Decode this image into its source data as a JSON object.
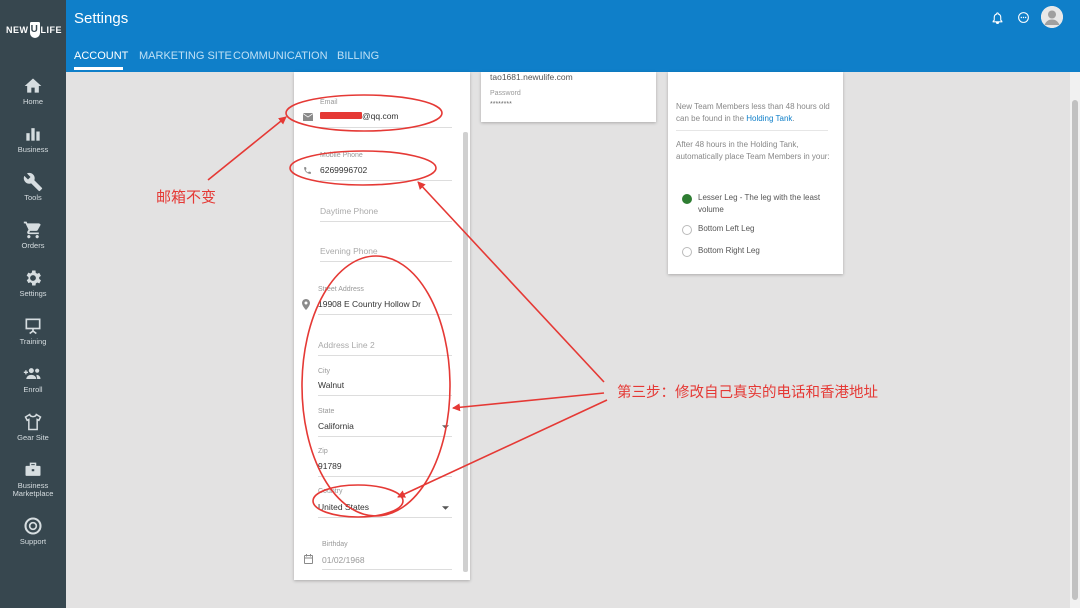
{
  "sidebar": {
    "logo_left": "NEW",
    "logo_mid": "U",
    "logo_right": "LIFE",
    "items": [
      {
        "label": "Home",
        "icon": "home-icon"
      },
      {
        "label": "Business",
        "icon": "bar-chart-icon"
      },
      {
        "label": "Tools",
        "icon": "wrench-icon"
      },
      {
        "label": "Orders",
        "icon": "cart-icon"
      },
      {
        "label": "Settings",
        "icon": "gear-icon"
      },
      {
        "label": "Training",
        "icon": "presentation-icon"
      },
      {
        "label": "Enroll",
        "icon": "add-people-icon"
      },
      {
        "label": "Gear Site",
        "icon": "shirt-icon"
      },
      {
        "label": "Business Marketplace",
        "icon": "briefcase-icon"
      },
      {
        "label": "Support",
        "icon": "lifebuoy-icon"
      }
    ]
  },
  "header": {
    "title": "Settings",
    "tabs": [
      "ACCOUNT",
      "MARKETING SITE",
      "COMMUNICATION",
      "BILLING"
    ],
    "active_tab": "ACCOUNT"
  },
  "form": {
    "email_label": "Email",
    "email_value": "@qq.com",
    "mobile_label": "Mobile Phone",
    "mobile_value": "6269996702",
    "daytime_placeholder": "Daytime Phone",
    "evening_placeholder": "Evening Phone",
    "street_label": "Street Address",
    "street_value": "19908 E Country Hollow Dr",
    "address2_placeholder": "Address Line 2",
    "city_label": "City",
    "city_value": "Walnut",
    "state_label": "State",
    "state_value": "California",
    "zip_label": "Zip",
    "zip_value": "91789",
    "country_label": "Country",
    "country_value": "United States",
    "birthday_label": "Birthday",
    "birthday_value": "01/02/1968"
  },
  "site_card": {
    "url": "tao1681.newulife.com",
    "password_label": "Password",
    "password_value": "********"
  },
  "tank_card": {
    "text1_before": "New Team Members less than 48 hours old can be found in the ",
    "text1_link": "Holding Tank",
    "text1_after": ".",
    "text2": "After 48 hours in the Holding Tank, automatically place Team Members in your:",
    "options": [
      "Lesser Leg - The leg with the least volume",
      "Bottom Left Leg",
      "Bottom Right Leg"
    ],
    "selected_index": 0
  },
  "annotations": {
    "email_note": "邮箱不变",
    "step_note": "第三步：修改自己真实的电话和香港地址"
  },
  "colors": {
    "header": "#0f7fc9",
    "sidebar": "#37474f",
    "annotation": "#e53935"
  }
}
